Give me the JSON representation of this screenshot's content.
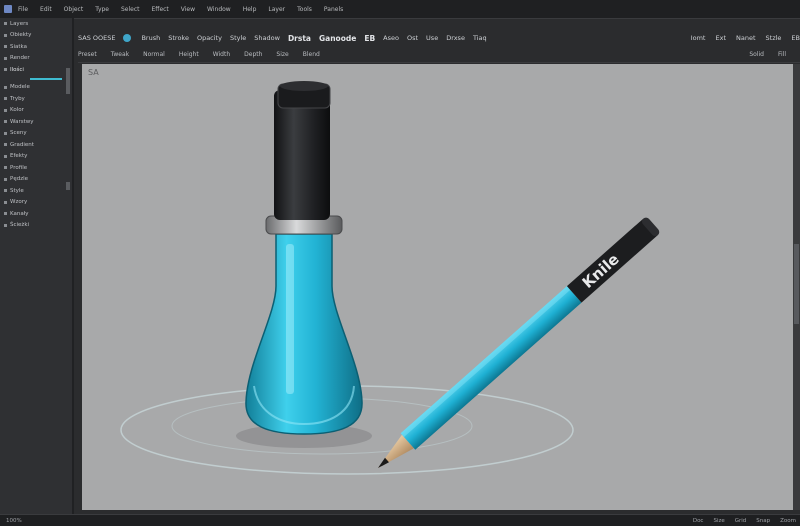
{
  "menubar": {
    "items": [
      "File",
      "Edit",
      "Object",
      "Type",
      "Select",
      "Effect",
      "View",
      "Window",
      "Help",
      "Layer",
      "Tools",
      "Panels"
    ]
  },
  "toolbar1": {
    "left_label": "SAS OOESE",
    "chips": [
      "Brush",
      "Stroke",
      "Opacity",
      "Style",
      "Shadow"
    ],
    "bold_chips": [
      "Drsta",
      "Ganoode",
      "EB"
    ],
    "more_chips": [
      "Aseo",
      "Ost",
      "Use",
      "Drxse",
      "Tiaq"
    ],
    "right_items": [
      "Iomt",
      "Ext",
      "Nanet",
      "Stzle",
      "EB"
    ]
  },
  "toolbar2": {
    "items": [
      "Preset",
      "Tweak",
      "Normal",
      "Height",
      "Width",
      "Depth",
      "Size",
      "Blend"
    ],
    "right_items": [
      "Solid",
      "Fill"
    ]
  },
  "sidebar": {
    "items": [
      "Layers",
      "Obiekty",
      "Siatka",
      "Render",
      "Ilości",
      "Modele",
      "Tryby",
      "Kolor",
      "Warstwy",
      "Sceny",
      "Gradient",
      "Efekty",
      "Profile",
      "Pędzle",
      "Style",
      "Wzory",
      "Kanały",
      "Ścieżki"
    ]
  },
  "canvas": {
    "label": "SA",
    "pencil_text": "Knile",
    "colors": {
      "background": "#a8a9aa",
      "cyan": "#25b6d6",
      "dark": "#2b2c2e"
    }
  },
  "statusbar": {
    "left": "100%",
    "right_items": [
      "Doc",
      "Size",
      "Grid",
      "Snap",
      "Zoom"
    ]
  }
}
